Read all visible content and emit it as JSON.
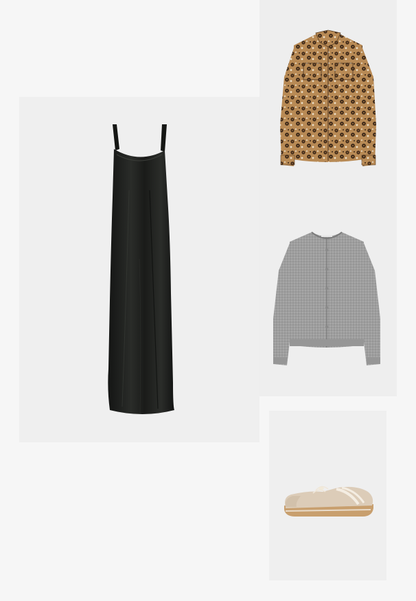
{
  "collage": {
    "background": "#f6f6f6",
    "items": [
      {
        "id": "dress",
        "product": "black satin slip dress",
        "color": "#1c1d1b"
      },
      {
        "id": "leopard-shirt",
        "product": "leopard print shirt",
        "color": "#9a6c3c"
      },
      {
        "id": "cardigan",
        "product": "grey knit cardigan",
        "color": "#9b9b9b"
      },
      {
        "id": "sneaker",
        "product": "beige suede sneaker",
        "color": "#d9cbb8"
      }
    ]
  }
}
